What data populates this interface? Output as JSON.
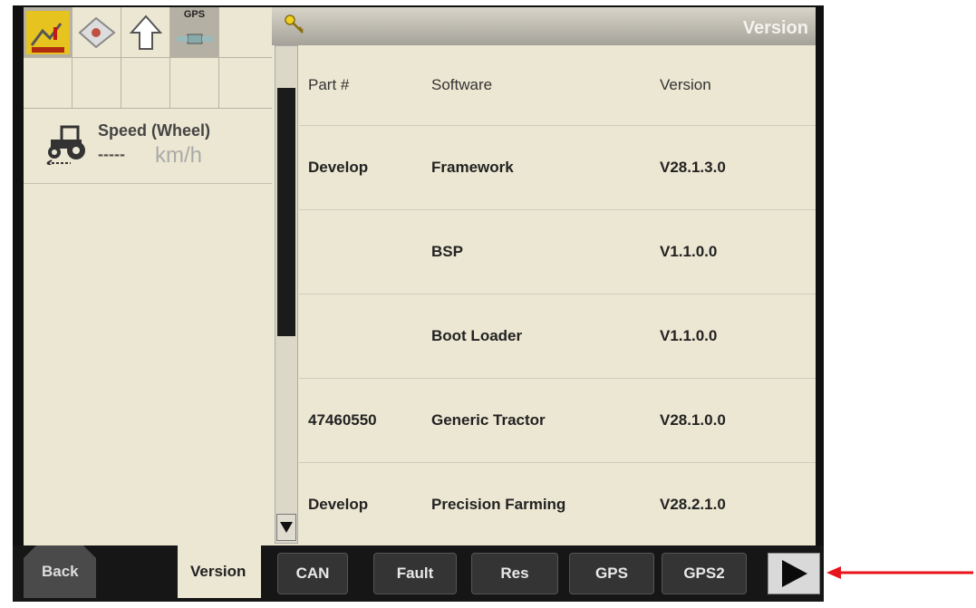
{
  "window": {
    "title": "Version"
  },
  "status_icons": {
    "gps_label": "GPS"
  },
  "speed": {
    "title": "Speed (Wheel)",
    "value": "-----",
    "unit": "km/h"
  },
  "table": {
    "headers": [
      "Part #",
      "Software",
      "Version"
    ],
    "rows": [
      {
        "part": "Develop",
        "software": "Framework",
        "version": "V28.1.3.0"
      },
      {
        "part": "",
        "software": "BSP",
        "version": "V1.1.0.0"
      },
      {
        "part": "",
        "software": "Boot Loader",
        "version": "V1.1.0.0"
      },
      {
        "part": "47460550",
        "software": "Generic Tractor",
        "version": "V28.1.0.0"
      },
      {
        "part": "Develop",
        "software": "Precision Farming",
        "version": "V28.2.1.0"
      }
    ]
  },
  "bottom_bar": {
    "back_label": "Back",
    "version_label": "Version",
    "buttons": [
      "CAN",
      "Fault",
      "Res",
      "GPS",
      "GPS2"
    ]
  },
  "colors": {
    "panel": "#ece7d2",
    "annotation_arrow": "#e8141c"
  }
}
